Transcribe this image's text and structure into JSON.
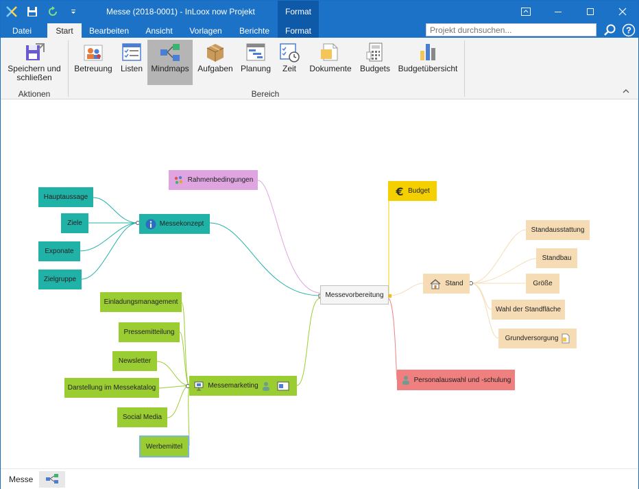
{
  "window": {
    "title": "Messe (2018-0001) - InLoox now Projekt",
    "context_tab_title": "Format"
  },
  "tabs": [
    {
      "label": "Datei",
      "state": "normal"
    },
    {
      "label": "Start",
      "state": "active"
    },
    {
      "label": "Bearbeiten",
      "state": "normal"
    },
    {
      "label": "Ansicht",
      "state": "normal"
    },
    {
      "label": "Vorlagen",
      "state": "normal"
    },
    {
      "label": "Berichte",
      "state": "normal"
    },
    {
      "label": "Format",
      "state": "contextual"
    }
  ],
  "search": {
    "placeholder": "Projekt durchsuchen...",
    "value": ""
  },
  "ribbon": {
    "groups": [
      {
        "label": "Aktionen"
      },
      {
        "label": "Bereich"
      }
    ],
    "buttons": [
      {
        "label_line1": "Speichern und",
        "label_line2": "schließen",
        "icon": "save-close-icon"
      },
      {
        "label_line1": "Betreuung",
        "label_line2": "",
        "icon": "people-icon"
      },
      {
        "label_line1": "Listen",
        "label_line2": "",
        "icon": "list-icon"
      },
      {
        "label_line1": "Mindmaps",
        "label_line2": "",
        "icon": "mindmap-icon",
        "selected": true
      },
      {
        "label_line1": "Aufgaben",
        "label_line2": "",
        "icon": "box-icon"
      },
      {
        "label_line1": "Planung",
        "label_line2": "",
        "icon": "gantt-icon"
      },
      {
        "label_line1": "Zeit",
        "label_line2": "",
        "icon": "time-icon"
      },
      {
        "label_line1": "Dokumente",
        "label_line2": "",
        "icon": "documents-icon"
      },
      {
        "label_line1": "Budgets",
        "label_line2": "",
        "icon": "calculator-icon"
      },
      {
        "label_line1": "Budgetübersicht",
        "label_line2": "",
        "icon": "bar-chart-icon"
      }
    ]
  },
  "mindmap": {
    "colors": {
      "teal": "#20b2a6",
      "green": "#9acd32",
      "pink": "#dea5e0",
      "yellow": "#f5d000",
      "peach": "#f5dcb4",
      "red": "#f08080",
      "root": "#f5f5f5"
    },
    "root": {
      "label": "Messevorbereitung"
    },
    "nodes": [
      {
        "id": "rahmen",
        "label": "Rahmenbedingungen",
        "icon": "dots-icon"
      },
      {
        "id": "konzept",
        "label": "Messekonzept",
        "icon": "info-icon"
      },
      {
        "id": "haupt",
        "label": "Hauptaussage"
      },
      {
        "id": "ziele",
        "label": "Ziele"
      },
      {
        "id": "exponate",
        "label": "Exponate"
      },
      {
        "id": "zielgruppe",
        "label": "Zielgruppe"
      },
      {
        "id": "marketing",
        "label": "Messemarketing",
        "icon": "presentation-icon"
      },
      {
        "id": "einladung",
        "label": "Einladungsmanagement"
      },
      {
        "id": "presse",
        "label": "Pressemitteilung"
      },
      {
        "id": "newsletter",
        "label": "Newsletter"
      },
      {
        "id": "katalog",
        "label": "Darstellung im Messekatalog"
      },
      {
        "id": "social",
        "label": "Social Media"
      },
      {
        "id": "werbe",
        "label": "Werbemittel"
      },
      {
        "id": "budget",
        "label": "Budget",
        "icon": "euro-icon"
      },
      {
        "id": "stand",
        "label": "Stand",
        "icon": "house-icon"
      },
      {
        "id": "ausstattung",
        "label": "Standausstattung"
      },
      {
        "id": "standbau",
        "label": "Standbau"
      },
      {
        "id": "groesse",
        "label": "Größe"
      },
      {
        "id": "wahl",
        "label": "Wahl der Standfläche"
      },
      {
        "id": "grundversorgung",
        "label": "Grundversorgung"
      },
      {
        "id": "personal",
        "label": "Personalauswahl und -schulung",
        "icon": "person-icon"
      }
    ]
  },
  "status": {
    "text": "Messe"
  }
}
